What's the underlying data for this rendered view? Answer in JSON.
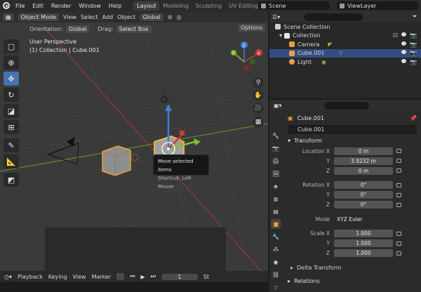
{
  "topbar": {
    "menus": [
      "File",
      "Edit",
      "Render",
      "Window",
      "Help"
    ],
    "workspace_tabs": [
      "Layout",
      "Modeling",
      "Sculpting",
      "UV Editing",
      "Te"
    ],
    "scene": "Scene",
    "view_layer": "ViewLayer"
  },
  "viewport": {
    "mode": "Object Mode",
    "menus": [
      "View",
      "Select",
      "Add",
      "Object"
    ],
    "transform_orientation": "Global",
    "orientation_label": "Orientation:",
    "orientation_value": "Global",
    "drag_label": "Drag:",
    "drag_value": "Select Box",
    "options": "Options",
    "perspective_title": "User Perspective",
    "collection_line": "(1) Collection | Cube.001",
    "tooltip_title": "Move selected items",
    "tooltip_shortcut": "Shortcut: Left Mouse",
    "gizmo_labels": {
      "x": "X",
      "y": "Y",
      "z": "Z"
    }
  },
  "timeline": {
    "menus": [
      "Playback",
      "Keying",
      "View",
      "Marker"
    ],
    "current_frame": "1",
    "extra": "St"
  },
  "outliner": {
    "items": [
      {
        "label": "Scene Collection",
        "icon_color": "#cfcfcf"
      },
      {
        "label": "Collection",
        "icon_color": "#e6e6e6"
      },
      {
        "label": "Camera",
        "icon_color": "#e8a04a"
      },
      {
        "label": "Cube.001",
        "icon_color": "#e8a04a"
      },
      {
        "label": "Light",
        "icon_color": "#e8a04a"
      }
    ]
  },
  "properties": {
    "object_name_header": "Cube.001",
    "object_name_field": "Cube.001",
    "transform_label": "Transform",
    "location": [
      {
        "axis": "Location X",
        "value": "0 m"
      },
      {
        "axis": "Y",
        "value": "3.9232 m"
      },
      {
        "axis": "Z",
        "value": "0 m"
      }
    ],
    "rotation": [
      {
        "axis": "Rotation X",
        "value": "0°"
      },
      {
        "axis": "Y",
        "value": "0°"
      },
      {
        "axis": "Z",
        "value": "0°"
      }
    ],
    "mode_label": "Mode",
    "mode_value": "XYZ Euler",
    "scale": [
      {
        "axis": "Scale X",
        "value": "1.000"
      },
      {
        "axis": "Y",
        "value": "1.000"
      },
      {
        "axis": "Z",
        "value": "1.000"
      }
    ],
    "delta_transform": "Delta Transform",
    "relations": "Relations"
  },
  "colors": {
    "accent": "#4772b3",
    "selection_orange": "#f0a030",
    "x_axis": "#cc3a3a",
    "y_axis": "#7fbf2f",
    "z_axis": "#3d7fd8"
  }
}
